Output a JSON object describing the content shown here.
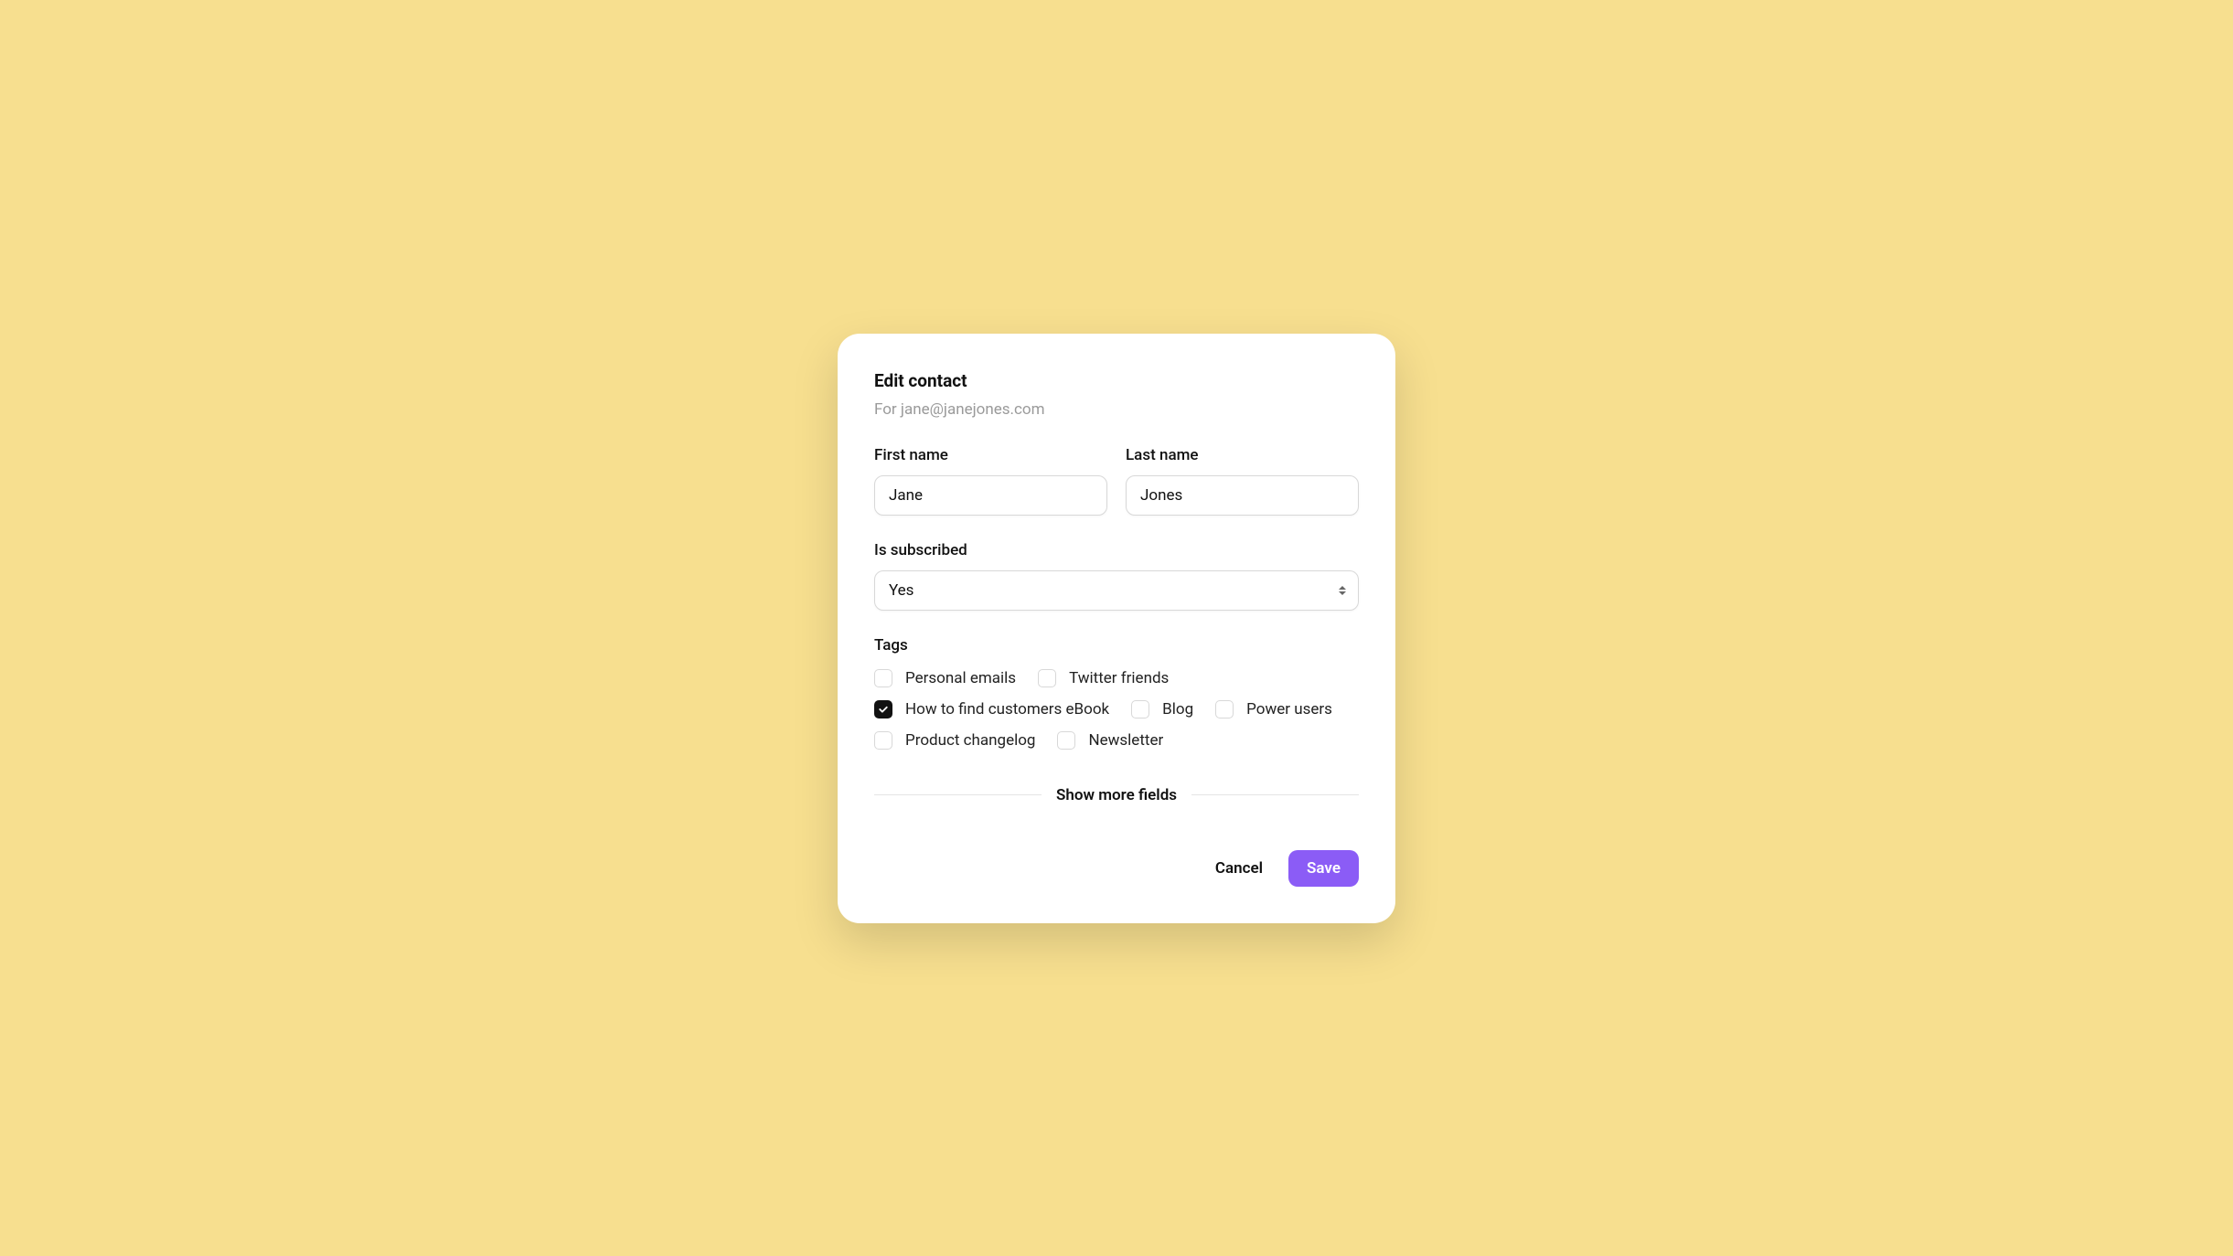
{
  "modal": {
    "title": "Edit contact",
    "subtitle": "For jane@janejones.com"
  },
  "form": {
    "first_name": {
      "label": "First name",
      "value": "Jane"
    },
    "last_name": {
      "label": "Last name",
      "value": "Jones"
    },
    "is_subscribed": {
      "label": "Is subscribed",
      "value": "Yes"
    },
    "tags": {
      "label": "Tags",
      "items": [
        {
          "label": "Personal emails",
          "checked": false
        },
        {
          "label": "Twitter friends",
          "checked": false
        },
        {
          "label": "How to find customers eBook",
          "checked": true
        },
        {
          "label": "Blog",
          "checked": false
        },
        {
          "label": "Power users",
          "checked": false
        },
        {
          "label": "Product changelog",
          "checked": false
        },
        {
          "label": "Newsletter",
          "checked": false
        }
      ]
    }
  },
  "divider": {
    "show_more": "Show more fields"
  },
  "actions": {
    "cancel": "Cancel",
    "save": "Save"
  }
}
